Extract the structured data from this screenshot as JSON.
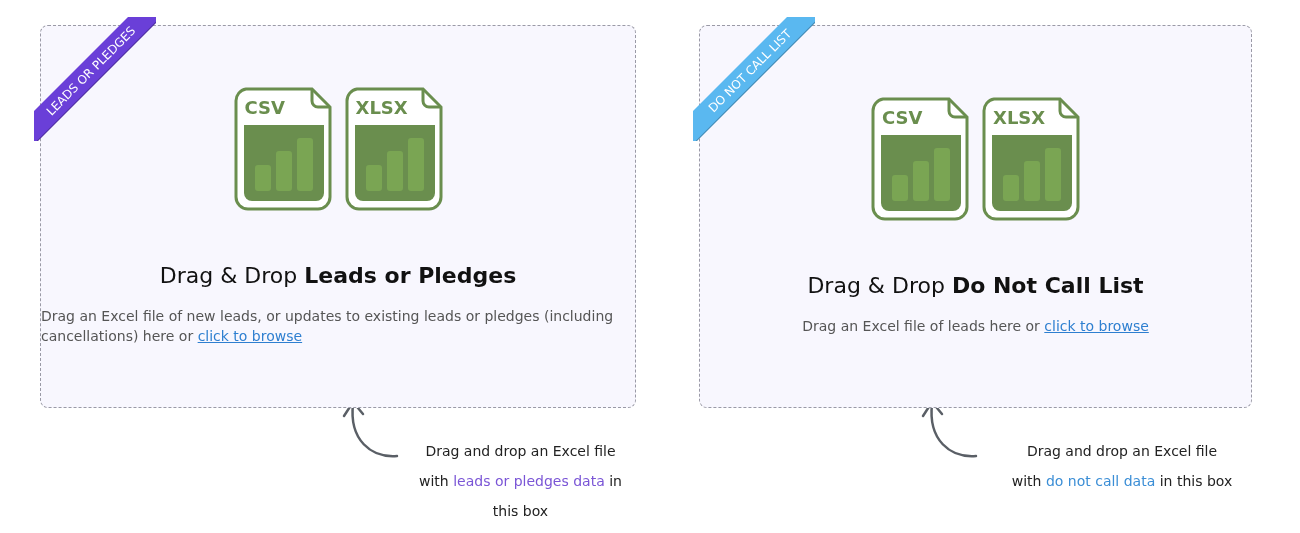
{
  "zones": [
    {
      "ribbon": {
        "label": "LEADS OR PLEDGES",
        "color": "#6a3fd8"
      },
      "files": [
        "CSV",
        "XLSX"
      ],
      "heading": "Drag & Drop **Leads or Pledges**",
      "description": "Drag an Excel file of new leads, or updates to existing leads or pledges (including cancellations) here or",
      "link": "click to browse",
      "note": {
        "first_line": "Drag and drop an Excel file",
        "before": "with",
        "highlight": "leads or pledges data",
        "after": "in this box",
        "color": "#7a55d6"
      }
    },
    {
      "ribbon": {
        "label": "DO NOT CALL LIST",
        "color": "#5ab8f0"
      },
      "files": [
        "CSV",
        "XLSX"
      ],
      "heading": "Drag & Drop **Do Not Call List**",
      "description": "Drag an Excel file of leads here or",
      "link": "click to browse",
      "note": {
        "first_line": "Drag and drop an Excel file",
        "before": "with",
        "highlight": "do not call data",
        "after": "in this box",
        "color": "#3b8ed6"
      }
    }
  ]
}
